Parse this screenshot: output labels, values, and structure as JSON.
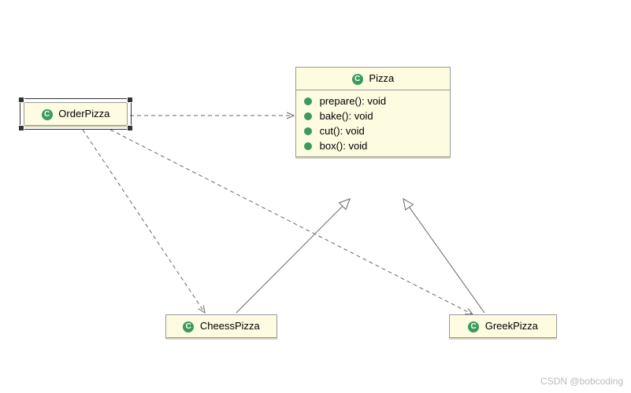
{
  "classes": {
    "orderPizza": {
      "name": "OrderPizza"
    },
    "pizza": {
      "name": "Pizza",
      "methods": [
        "prepare(): void",
        "bake(): void",
        "cut(): void",
        "box(): void"
      ]
    },
    "cheessPizza": {
      "name": "CheessPizza"
    },
    "greekPizza": {
      "name": "GreekPizza"
    }
  },
  "iconLabel": "C",
  "relationships": [
    {
      "from": "OrderPizza",
      "to": "Pizza",
      "type": "dependency-dashed-arrow"
    },
    {
      "from": "OrderPizza",
      "to": "CheessPizza",
      "type": "dependency-dashed-arrow"
    },
    {
      "from": "OrderPizza",
      "to": "GreekPizza",
      "type": "dependency-dashed-arrow"
    },
    {
      "from": "CheessPizza",
      "to": "Pizza",
      "type": "generalization-hollow-triangle"
    },
    {
      "from": "GreekPizza",
      "to": "Pizza",
      "type": "generalization-hollow-triangle"
    }
  ],
  "watermark": "CSDN @bobcoding"
}
